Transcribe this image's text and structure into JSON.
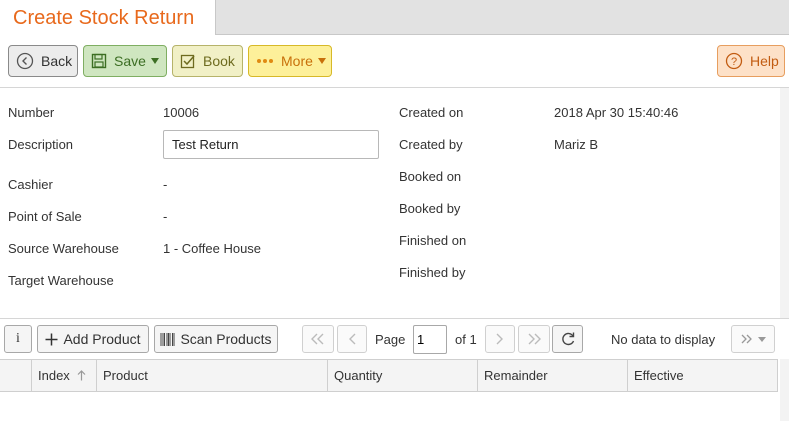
{
  "tab": {
    "title": "Create Stock Return"
  },
  "toolbar": {
    "back_label": "Back",
    "save_label": "Save",
    "book_label": "Book",
    "more_label": "More",
    "help_label": "Help"
  },
  "form": {
    "left": [
      {
        "label": "Number",
        "value": "10006"
      },
      {
        "label": "Description",
        "value": "Test Return"
      },
      {
        "label": "Cashier",
        "value": "-"
      },
      {
        "label": "Point of Sale",
        "value": "-"
      },
      {
        "label": "Source Warehouse",
        "value": "1 - Coffee House"
      },
      {
        "label": "Target Warehouse",
        "value": ""
      }
    ],
    "right": [
      {
        "label": "Created on",
        "value": "2018 Apr 30 15:40:46"
      },
      {
        "label": "Created by",
        "value": "Mariz B"
      },
      {
        "label": "Booked on",
        "value": ""
      },
      {
        "label": "Booked by",
        "value": ""
      },
      {
        "label": "Finished on",
        "value": ""
      },
      {
        "label": "Finished by",
        "value": ""
      }
    ]
  },
  "grid_toolbar": {
    "info_label": "i",
    "add_product_label": "Add Product",
    "scan_products_label": "Scan Products",
    "page_label": "Page",
    "page_value": "1",
    "of_label": "of 1",
    "status": "No data to display"
  },
  "grid": {
    "columns": [
      "Index",
      "Product",
      "Quantity",
      "Remainder",
      "Effective"
    ]
  }
}
